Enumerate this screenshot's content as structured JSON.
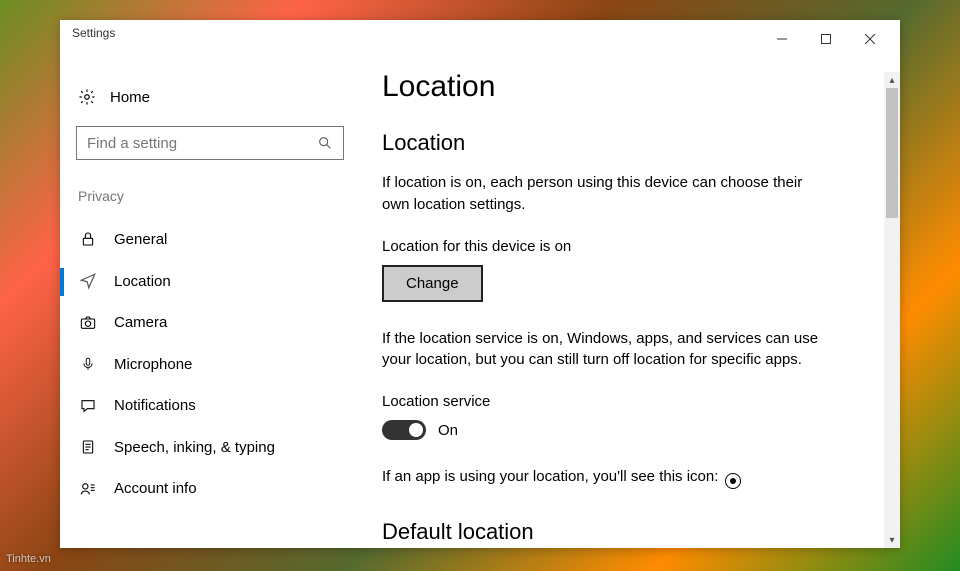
{
  "window": {
    "title": "Settings"
  },
  "sidebar": {
    "home_label": "Home",
    "search_placeholder": "Find a setting",
    "group_label": "Privacy",
    "items": [
      {
        "label": "General"
      },
      {
        "label": "Location"
      },
      {
        "label": "Camera"
      },
      {
        "label": "Microphone"
      },
      {
        "label": "Notifications"
      },
      {
        "label": "Speech, inking, & typing"
      },
      {
        "label": "Account info"
      }
    ]
  },
  "main": {
    "page_title": "Location",
    "section_title": "Location",
    "intro_text": "If location is on, each person using this device can choose their own location settings.",
    "device_status": "Location for this device is on",
    "change_button": "Change",
    "service_text": "If the location service is on, Windows, apps, and services can use your location, but you can still turn off location for specific apps.",
    "service_label": "Location service",
    "toggle_state": "On",
    "icon_text": "If an app is using your location, you'll see this icon:",
    "default_heading": "Default location"
  },
  "watermark": "Tinhte.vn"
}
